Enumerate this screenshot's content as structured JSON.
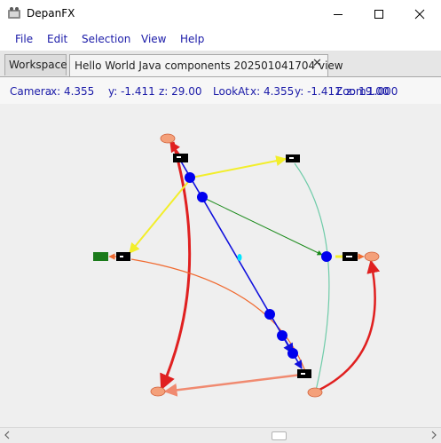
{
  "window": {
    "title": "DepanFX",
    "controls": {
      "minimize_icon": "minimize-icon",
      "maximize_icon": "maximize-icon",
      "close_icon": "close-icon"
    }
  },
  "menu": {
    "items": [
      {
        "label": "File"
      },
      {
        "label": "Edit"
      },
      {
        "label": "Selection"
      },
      {
        "label": "View"
      },
      {
        "label": "Help"
      }
    ]
  },
  "tabs": [
    {
      "label": "Workspace",
      "active": false
    },
    {
      "label": "Hello World Java components 202501041704 view",
      "active": true,
      "closable": true,
      "close_glyph": "✕"
    }
  ],
  "camera": {
    "camera_label": "Camera",
    "camera_x": "x: 4.355",
    "camera_y": "y: -1.411",
    "camera_z": "z: 29.00",
    "lookat_label": "LookAt",
    "lookat_x": "x: 4.355",
    "lookat_y": "y: -1.411",
    "lookat_z": "z: 19.00",
    "zoom_label": "Zoom",
    "zoom_value": "1.000"
  },
  "graph": {
    "colors": {
      "salmon_node": "#f4a07a",
      "blue_node": "#0000ee",
      "black_label": "#000000",
      "green_label": "#1a7a1a",
      "cyan_mark": "#00e5ff",
      "edge_red": "#e02020",
      "edge_orange": "#f06a30",
      "edge_yellow": "#f2ee2a",
      "edge_green": "#1a8a1a",
      "edge_blue": "#1010dd",
      "edge_teal": "#6ecba8",
      "edge_salmon": "#f08a70"
    }
  }
}
